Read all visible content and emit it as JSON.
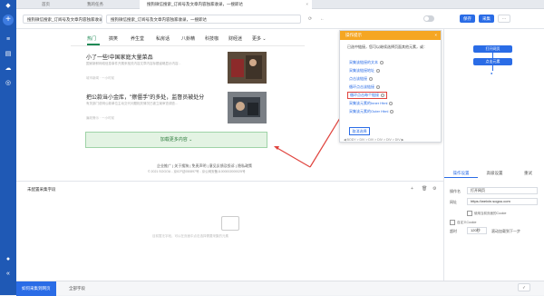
{
  "tabs": [
    {
      "label": "首页"
    },
    {
      "label": "我的任务"
    },
    {
      "label": "搜狗微信搜索_订阅号及文章内容独家收录，一搜即达"
    }
  ],
  "address": {
    "url_left": "搜狗微信搜索_订阅号及文章内容独家收录，一搜...",
    "url_right": "搜狗微信搜索_订阅号及文章内容独家收录，一搜即达"
  },
  "toolbar": {
    "save": "保存",
    "collect": "采集",
    "more": "···"
  },
  "site_nav": {
    "items": [
      "热门",
      "搞笑",
      "养生堂",
      "私房话",
      "八卦精",
      "科技咖",
      "财经迷",
      "更多 ⌄"
    ]
  },
  "news": [
    {
      "title": "小了一些!中国家庭大量菜品",
      "desc": "国家新鲜网络信息事件开展来相关内容文章内容标题省略显示内容...",
      "meta": "城市新闻 · 一小时前"
    },
    {
      "title": "把公款当小金库，\"擦僵手\"的多处，监督员被处分",
      "desc": "有关部门说明公款单位主动交代问题相关情况已被立案审查调查...",
      "meta": "廉政警示 · 一小时前"
    }
  ],
  "load_more": "加载更多内容 ⌄",
  "footer": {
    "links": "企业推广 | 关于搜狗 | 免责声明 | 意见反馈及投诉 | 隐私政策",
    "copyright": "© 2021 SOGOU - 京ICP证050897号 - 京公网安备11000002000025号"
  },
  "popup": {
    "title": "操作提示",
    "tip": "已选中链接，您可以继续选择页面其他元素，或：",
    "options": [
      "采集该链接的文本",
      "采集该链接地址",
      "点击该链接",
      "循环点击该链接",
      "循环点击每个链接",
      "采集该元素的Inner Html",
      "采集该元素的Outer Html"
    ],
    "cancel": "取消选择",
    "path": "◀ BODY > DIV > DIV > DIV > DIV > DIV ▶"
  },
  "bottom_panel": {
    "title": "未配置采集字段",
    "empty_text": "目前暂无字段，可以在页面中点击选择需要采集的元素"
  },
  "bottom_bar": {
    "tab1": "如何采集到网页",
    "tab2": "全部字段"
  },
  "flow": {
    "nodes": [
      "打开网页",
      "点击元素"
    ]
  },
  "right_tabs": [
    "操作设置",
    "高级设置",
    "重试"
  ],
  "settings": {
    "label_open": "操作名",
    "open_value": "打开网页",
    "label_url": "网址",
    "url_value": "https://weixin.sogou.com",
    "check1": "使用当前页面的Cookie",
    "check2": "自定义Cookie",
    "label_timeout": "超时",
    "timeout_value": "120秒",
    "timeout_note": "滚动加载到下一步"
  },
  "colors": {
    "sidebar": "#1f59b5",
    "accent": "#2a6ce6",
    "popup_header": "#f5a623",
    "highlight": "#e0443e",
    "green": "#1f8a55"
  }
}
